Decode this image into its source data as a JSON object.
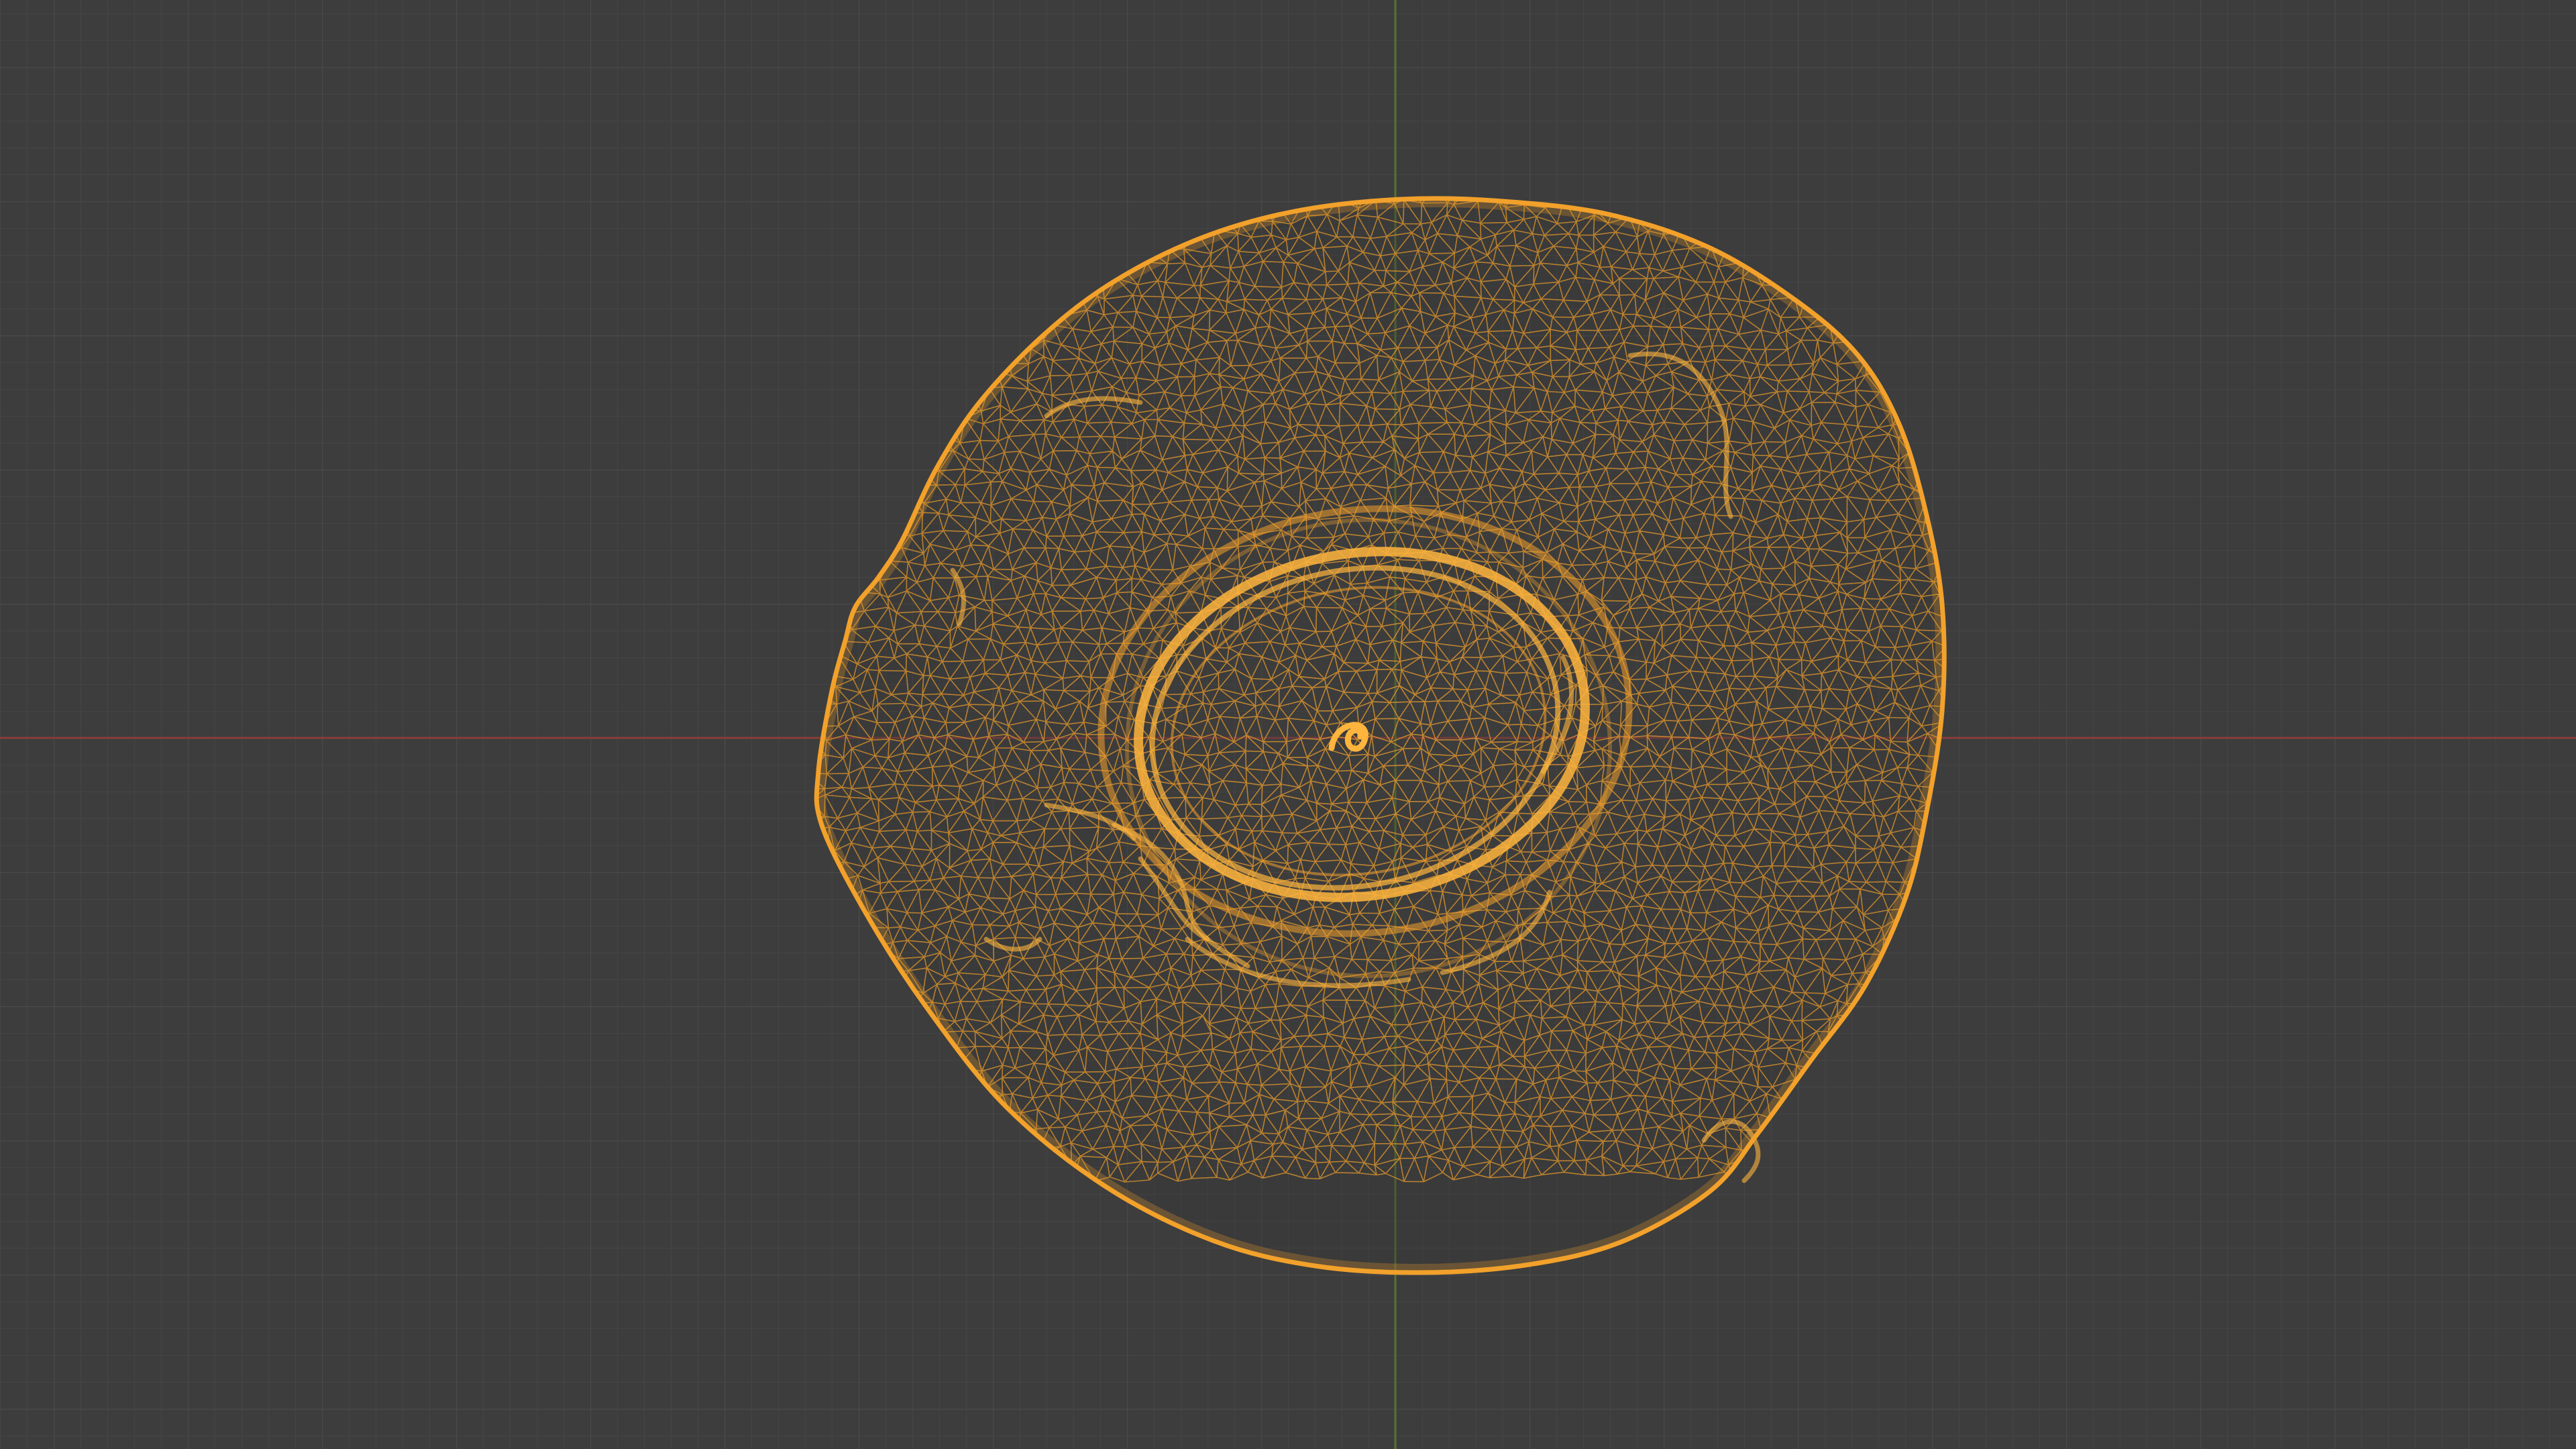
{
  "viewport": {
    "background_color": "#3d3d3d",
    "grid": true,
    "grid_minor_color": "#454545",
    "grid_major_color": "#4b4b4b",
    "x_axis_color": "#8a3c3c",
    "y_axis_color": "#55752e"
  },
  "mesh": {
    "display_mode": "wireframe",
    "selected": true,
    "wire_color": "#f2a12b",
    "highlight_color": "#ffb53d"
  }
}
